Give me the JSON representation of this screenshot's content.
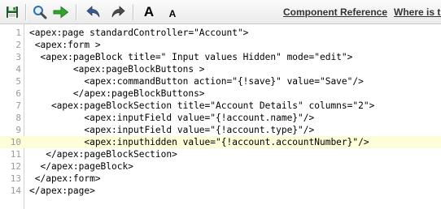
{
  "toolbar": {
    "icons": [
      "save-icon",
      "search-icon",
      "go-to-line-icon",
      "undo-icon",
      "redo-icon"
    ],
    "font_increase_label": "A",
    "font_decrease_label": "A",
    "link_component_reference": "Component Reference",
    "link_where_is_this": "Where is this"
  },
  "editor": {
    "highlighted_line": 10,
    "lines": [
      {
        "num": "1",
        "text": "<apex:page standardController=\"Account\">"
      },
      {
        "num": "2",
        "text": " <apex:form >"
      },
      {
        "num": "3",
        "text": "  <apex:pageBlock title=\" Input values Hidden\" mode=\"edit\">"
      },
      {
        "num": "4",
        "text": "        <apex:pageBlockButtons >"
      },
      {
        "num": "5",
        "text": "          <apex:commandButton action=\"{!save}\" value=\"Save\"/>"
      },
      {
        "num": "6",
        "text": "        </apex:pageBlockButtons>"
      },
      {
        "num": "7",
        "text": "    <apex:pageBlockSection title=\"Account Details\" columns=\"2\">"
      },
      {
        "num": "8",
        "text": "          <apex:inputField value=\"{!account.name}\"/>"
      },
      {
        "num": "9",
        "text": "          <apex:inputField value=\"{!account.type}\"/>"
      },
      {
        "num": "10",
        "text": "          <apex:inputhidden value=\"{!account.accountNumber}\"/>"
      },
      {
        "num": "11",
        "text": "   </apex:pageBlockSection>"
      },
      {
        "num": "12",
        "text": "  </apex:pageBlock>"
      },
      {
        "num": "13",
        "text": " </apex:form>"
      },
      {
        "num": "14",
        "text": "</apex:page>"
      }
    ]
  }
}
